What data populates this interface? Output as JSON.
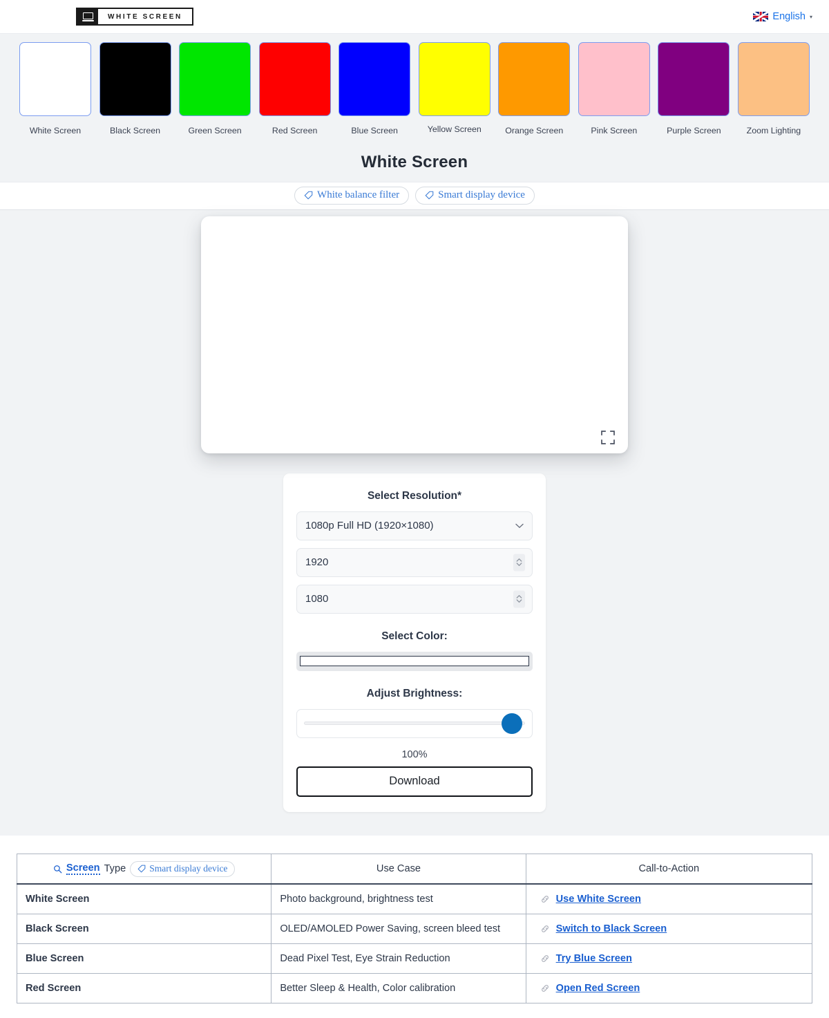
{
  "header": {
    "brand_name": "WHITE SCREEN",
    "brand_icon": "laptop-icon",
    "language": "English",
    "language_flag": "uk-flag-icon",
    "language_caret": "▾"
  },
  "swatches": [
    {
      "label": "White Screen",
      "color": "#ffffff"
    },
    {
      "label": "Black Screen",
      "color": "#000000"
    },
    {
      "label": "Green Screen",
      "color": "#00e600"
    },
    {
      "label": "Red Screen",
      "color": "#fe0000"
    },
    {
      "label": "Blue Screen",
      "color": "#0000fe"
    },
    {
      "label": "Yellow Screen",
      "color": "#ffff00"
    },
    {
      "label": "Orange Screen",
      "color": "#fe9900"
    },
    {
      "label": "Pink Screen",
      "color": "#ffc0cb"
    },
    {
      "label": "Purple Screen",
      "color": "#800080"
    },
    {
      "label": "Zoom Lighting",
      "color": "#fcc083"
    }
  ],
  "main": {
    "title": "White Screen",
    "tags": [
      {
        "label": "White balance filter"
      },
      {
        "label": "Smart display device"
      }
    ],
    "preview": {
      "color": "#ffffff",
      "fullscreen_icon": "fullscreen-expand-icon"
    }
  },
  "panel": {
    "resolution_label": "Select Resolution*",
    "resolution_value": "1080p Full HD (1920×1080)",
    "width_value": "1920",
    "height_value": "1080",
    "color_label": "Select Color:",
    "color_value": "#ffffff",
    "brightness_label": "Adjust Brightness:",
    "brightness_value": "100%",
    "download_label": "Download"
  },
  "table": {
    "headers": {
      "col1_keyword": "Screen",
      "col1_rest": "Type",
      "col1_tag": "Smart display device",
      "col2": "Use Case",
      "col3": "Call-to-Action"
    },
    "rows": [
      {
        "name": "White Screen",
        "use_case": "Photo background, brightness test",
        "cta": "Use White Screen"
      },
      {
        "name": "Black Screen",
        "use_case": "OLED/AMOLED Power Saving, screen bleed test",
        "cta": "Switch to Black Screen"
      },
      {
        "name": "Blue Screen",
        "use_case": "Dead Pixel Test, Eye Strain Reduction",
        "cta": "Try Blue Screen"
      },
      {
        "name": "Red Screen",
        "use_case": "Better Sleep & Health, Color calibration",
        "cta": "Open Red Screen"
      }
    ]
  },
  "colors": {
    "accent_blue": "#1a5fd0",
    "link_blue": "#1a73e8",
    "page_bg": "#f1f3f5",
    "slider_thumb": "#0b6fba"
  }
}
